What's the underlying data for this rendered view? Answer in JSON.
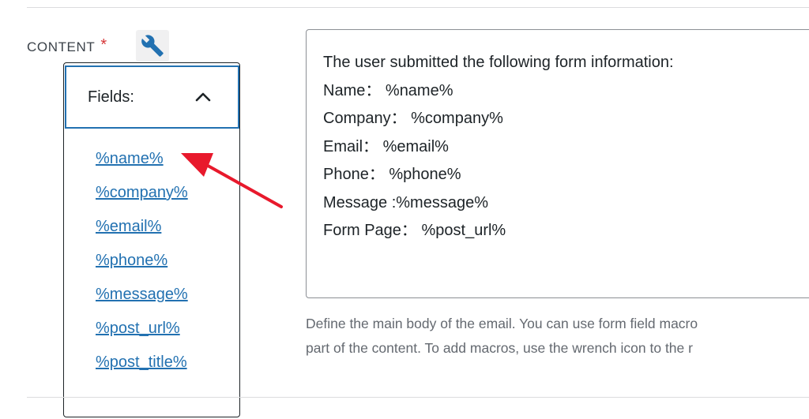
{
  "field": {
    "label": "CONTENT",
    "required_mark": "*"
  },
  "macros_dropdown": {
    "header": "Fields:",
    "items": [
      "%name%",
      "%company%",
      "%email%",
      "%phone%",
      "%message%",
      "%post_url%",
      "%post_title%"
    ]
  },
  "content": {
    "lines": [
      "The user submitted the following form information:",
      "Name： %name%",
      "Company： %company%",
      "Email： %email%",
      "Phone： %phone%",
      "Message :%message%",
      "Form Page： %post_url%"
    ]
  },
  "description": {
    "line1": "Define the main body of the email. You can use form field macro",
    "line2": "part of the content. To add macros, use the wrench icon to the r"
  },
  "icons": {
    "wrench": "wrench-icon",
    "chevron": "chevron-up-icon",
    "arrow": "red-pointer-arrow"
  },
  "colors": {
    "link": "#2271b1",
    "focus_border": "#2271b1",
    "required": "#d63638",
    "annotation_arrow": "#e8192c"
  }
}
